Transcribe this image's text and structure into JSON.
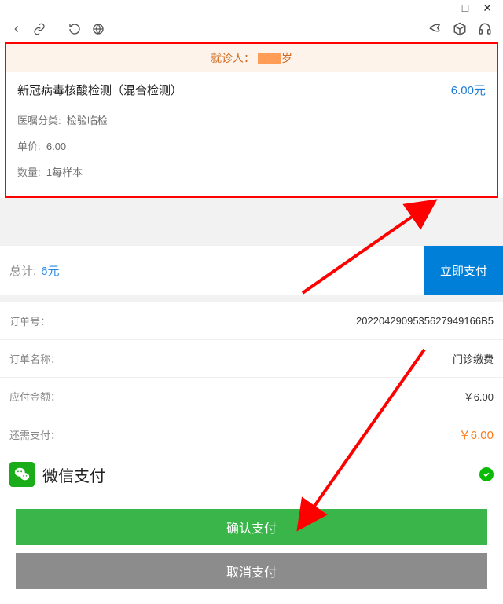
{
  "window": {
    "min": "—",
    "max": "□",
    "close": "✕"
  },
  "patient": {
    "label": "就诊人：",
    "suffix": "岁"
  },
  "item": {
    "name": "新冠病毒核酸检测（混合检测）",
    "price": "6.00元",
    "cat_label": "医嘱分类:",
    "cat_value": "检验临检",
    "unit_label": "单价:",
    "unit_value": "6.00",
    "qty_label": "数量:",
    "qty_value": "1每样本"
  },
  "total": {
    "label": "总计:",
    "amount": "6元",
    "pay_now": "立即支付"
  },
  "order": {
    "no_label": "订单号：",
    "no_value": "2022042909535627949166B5",
    "name_label": "订单名称：",
    "name_value": "门诊缴费",
    "due_label": "应付金额：",
    "due_value": "￥6.00",
    "remain_label": "还需支付：",
    "remain_value": "￥6.00"
  },
  "wechat": {
    "title": "微信支付"
  },
  "buttons": {
    "confirm": "确认支付",
    "cancel": "取消支付"
  }
}
